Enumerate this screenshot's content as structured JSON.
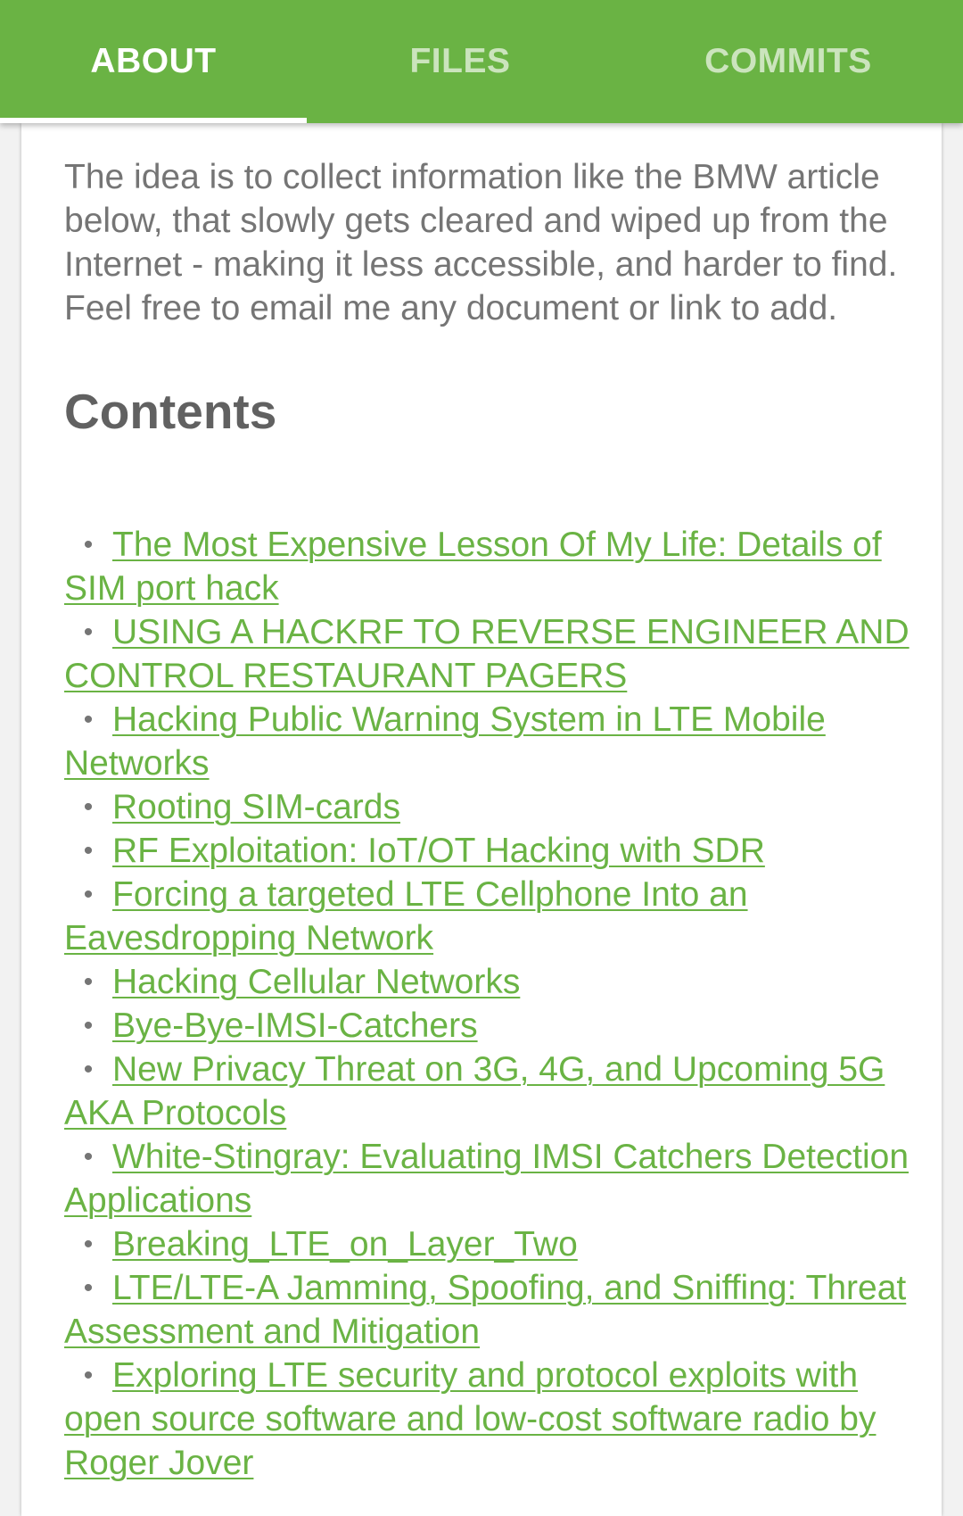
{
  "tabs": [
    {
      "label": "ABOUT",
      "active": true
    },
    {
      "label": "FILES",
      "active": false
    },
    {
      "label": "COMMITS",
      "active": false
    }
  ],
  "colors": {
    "accent": "#6ab344",
    "text": "#757575",
    "heading": "#616161",
    "card": "#ffffff"
  },
  "about": {
    "intro": "The idea is to collect information like the BMW article below, that slowly gets cleared and wiped up from the Internet - making it less accessible, and harder to find. Feel free to email me any document or link to add.",
    "contents_heading": "Contents",
    "bullet": "•",
    "links": [
      "The Most Expensive Lesson Of My Life: Details of SIM port hack",
      "USING A HACKRF TO REVERSE ENGINEER AND CONTROL RESTAURANT PAGERS",
      "Hacking Public Warning System in LTE Mobile Networks",
      "Rooting SIM-cards",
      "RF Exploitation: IoT/OT Hacking with SDR",
      "Forcing a targeted LTE Cellphone Into an Eavesdropping Network",
      "Hacking Cellular Networks",
      "Bye-Bye-IMSI-Catchers",
      "New Privacy Threat on 3G, 4G, and Upcoming 5G AKA Protocols ",
      "White-Stingray: Evaluating IMSI Catchers Detection Applications",
      "Breaking_LTE_on_Layer_Two",
      "LTE/LTE-A Jamming, Spoofing, and Sniffing: Threat Assessment and Mitigation",
      "Exploring LTE security and protocol exploits with open source software and low-cost software radio by Roger Jover"
    ]
  }
}
